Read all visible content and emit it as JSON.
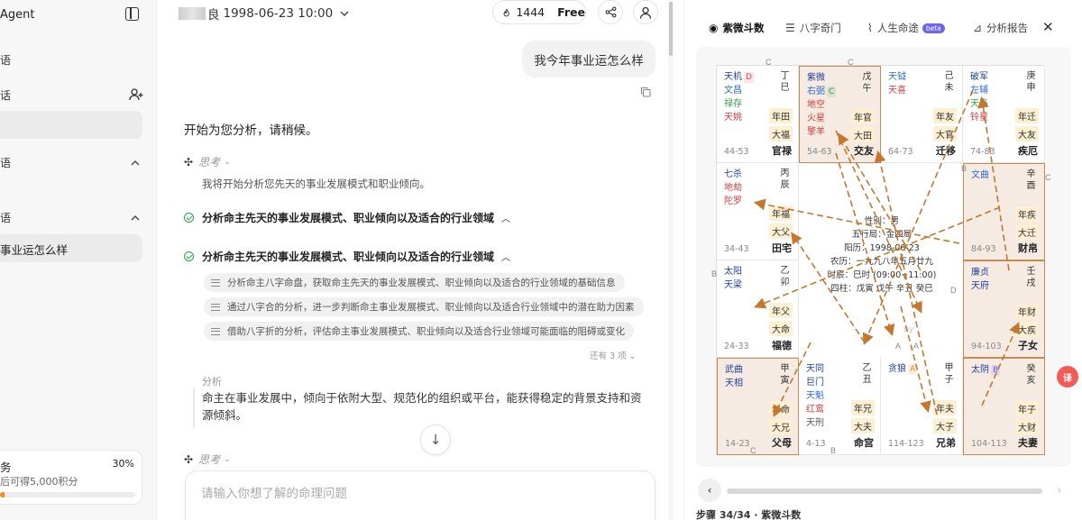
{
  "sidebar": {
    "title": "Agent",
    "sec1": "语",
    "sec2": "话",
    "sec3": "语",
    "sec4": "语",
    "chat_item": "事业运怎么样",
    "task": {
      "title": "务",
      "desc": "后可得5,000积分",
      "pct": "30%",
      "progress": 0.03
    }
  },
  "chat": {
    "name_suffix": "良",
    "date": "1998-06-23 10:00",
    "credits": "1444",
    "plan": "Free",
    "user_msg": "我今年事业运怎么样",
    "answer_start": "开始为您分析，请稍候。",
    "think_label": "思考",
    "think_text": "我将开始分析您先天的事业发展模式和职业倾向。",
    "step1": "分析命主先天的事业发展模式、职业倾向以及适合的行业领域",
    "step2": "分析命主先天的事业发展模式、职业倾向以及适合的行业领域",
    "sub1": "分析命主八字命盘，获取命主先天的事业发展模式、职业倾向以及适合的行业领域的基础信息",
    "sub2": "通过八字合的分析，进一步判断命主事业发展模式、职业倾向以及适合行业领域中的潜在助力因素",
    "sub3": "借助八字折的分析，评估命主事业发展模式、职业倾向以及适合行业领域可能面临的阻碍或变化",
    "more": "还有 3 项",
    "analysis_label": "分析",
    "analysis_text": "命主在事业发展中，倾向于依附大型、规范化的组织或平台，能获得稳定的背景支持和资源倾斜。",
    "think_label2": "思考",
    "input_placeholder": "请输入你想了解的命理问题"
  },
  "panel": {
    "tabs": [
      "紫微斗数",
      "八字奇门",
      "人生命途",
      "分析报告"
    ],
    "beta": "beta",
    "step_label": "步骤 34/34 · 紫微斗数"
  },
  "chart": {
    "center": [
      "性别：男",
      "五行局：金四局",
      "阳历：1998-06-23",
      "农历：一九九八年五月廿九",
      "时辰：巳时 (09:00~11:00)",
      "四柱：戊寅 戊午 辛丑 癸巳"
    ],
    "watermark": "by"
  },
  "palaces": [
    {
      "id": "p1",
      "stars": [
        {
          "t": "天机",
          "c": "#1f3fa0",
          "mk": "D",
          "mkc": "#e8434e"
        },
        {
          "t": "文昌",
          "c": "#2f6ad2"
        },
        {
          "t": "禄存",
          "c": "#2f9d49"
        },
        {
          "t": "天姚",
          "c": "#d03a3a"
        }
      ],
      "gz": "丁巳",
      "tags": [
        "年田",
        "大福"
      ],
      "age": "44-53",
      "name": "官禄"
    },
    {
      "id": "p2",
      "stars": [
        {
          "t": "紫微",
          "c": "#1f3fa0"
        },
        {
          "t": "右弼",
          "c": "#2f6ad2",
          "mk": "C",
          "mkc": "#2f9d49"
        },
        {
          "t": "地空",
          "c": "#d03a3a"
        },
        {
          "t": "火星",
          "c": "#d03a3a"
        },
        {
          "t": "擎羊",
          "c": "#d03a3a"
        }
      ],
      "gz": "戊午",
      "tags": [
        "年官",
        "大田"
      ],
      "age": "54-63",
      "name": "交友"
    },
    {
      "id": "p3",
      "stars": [
        {
          "t": "天钺",
          "c": "#2f6ad2"
        },
        {
          "t": "天喜",
          "c": "#d03a3a"
        }
      ],
      "gz": "己未",
      "tags": [
        "年友",
        "大官"
      ],
      "age": "64-73",
      "name": "迁移"
    },
    {
      "id": "p4",
      "stars": [
        {
          "t": "破军",
          "c": "#1f3fa0"
        },
        {
          "t": "左辅",
          "c": "#2f6ad2"
        },
        {
          "t": "天马",
          "c": "#2f9d49"
        },
        {
          "t": "铃星",
          "c": "#d03a3a"
        }
      ],
      "gz": "庚申",
      "tags": [
        "年迁",
        "大友"
      ],
      "age": "74-83",
      "name": "疾厄"
    },
    {
      "id": "p5",
      "stars": [
        {
          "t": "七杀",
          "c": "#1f3fa0"
        },
        {
          "t": "地劫",
          "c": "#d03a3a"
        },
        {
          "t": "陀罗",
          "c": "#d03a3a"
        }
      ],
      "gz": "丙辰",
      "tags": [
        "年福",
        "大父"
      ],
      "age": "34-43",
      "name": "田宅"
    },
    {
      "id": "p6",
      "stars": [
        {
          "t": "文曲",
          "c": "#2f6ad2"
        }
      ],
      "gz": "辛酉",
      "tags": [
        "年疾",
        "大迁"
      ],
      "age": "84-93",
      "name": "财帛"
    },
    {
      "id": "p7",
      "stars": [
        {
          "t": "太阳",
          "c": "#1f3fa0"
        },
        {
          "t": "天梁",
          "c": "#1f3fa0"
        }
      ],
      "gz": "乙卯",
      "tags": [
        "年父",
        "大命"
      ],
      "age": "24-33",
      "name": "福德"
    },
    {
      "id": "p8",
      "stars": [
        {
          "t": "廉贞",
          "c": "#1f3fa0"
        },
        {
          "t": "天府",
          "c": "#1f3fa0"
        }
      ],
      "gz": "壬戌",
      "tags": [
        "年财",
        "大疾"
      ],
      "age": "94-103",
      "name": "子女"
    },
    {
      "id": "p9",
      "stars": [
        {
          "t": "武曲",
          "c": "#1f3fa0"
        },
        {
          "t": "天相",
          "c": "#1f3fa0"
        }
      ],
      "gz": "甲寅",
      "tags": [
        "年命",
        "大兄"
      ],
      "age": "14-23",
      "name": "父母"
    },
    {
      "id": "p10",
      "stars": [
        {
          "t": "天同",
          "c": "#1f3fa0"
        },
        {
          "t": "巨门",
          "c": "#1f3fa0"
        },
        {
          "t": "天魁",
          "c": "#2f6ad2"
        },
        {
          "t": "红鸾",
          "c": "#d03a3a"
        },
        {
          "t": "天刑",
          "c": "#555"
        }
      ],
      "gz": "乙丑",
      "tags": [
        "年兄",
        "大夫"
      ],
      "age": "4-13",
      "name": "命宫"
    },
    {
      "id": "p11",
      "stars": [
        {
          "t": "贪狼",
          "c": "#1f3fa0",
          "mk": "A",
          "mkc": "#e08a1e"
        }
      ],
      "gz": "甲子",
      "tags": [
        "年夫",
        "大子"
      ],
      "age": "114-123",
      "name": "兄弟"
    },
    {
      "id": "p12",
      "stars": [
        {
          "t": "太阴",
          "c": "#1f3fa0",
          "mk": "B",
          "mkc": "#6d64f2"
        }
      ],
      "gz": "癸亥",
      "tags": [
        "年子",
        "大财"
      ],
      "age": "104-113",
      "name": "夫妻"
    }
  ],
  "arrow_labels": [
    "C",
    "C",
    "C",
    "B",
    "B",
    "D",
    "A",
    "A",
    "B",
    "C"
  ]
}
